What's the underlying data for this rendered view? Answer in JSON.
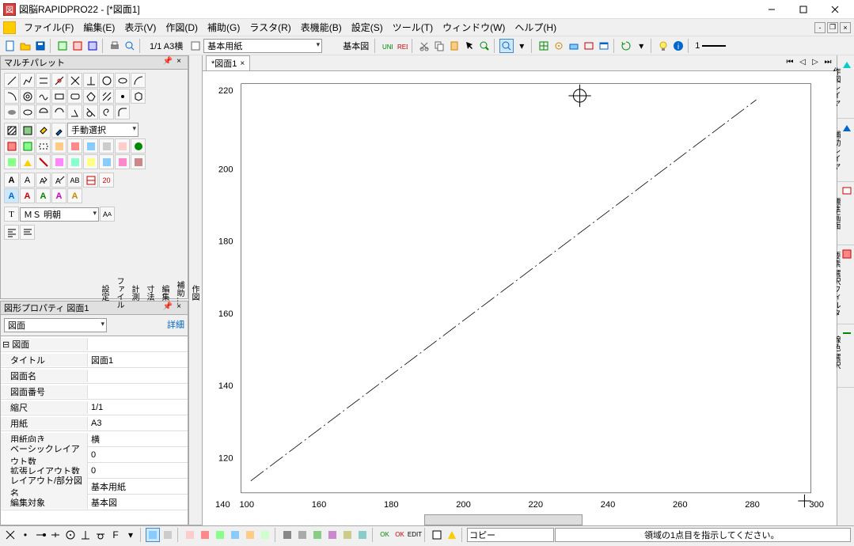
{
  "title": "図脳RAPIDPRO22 - [*図面1]",
  "menus": [
    "ファイル(F)",
    "編集(E)",
    "表示(V)",
    "作図(D)",
    "補助(G)",
    "ラスタ(R)",
    "表機能(B)",
    "設定(S)",
    "ツール(T)",
    "ウィンドウ(W)",
    "ヘルプ(H)"
  ],
  "page_info": "1/1 A3横",
  "paper_label": "基本用紙",
  "view_label": "基本図",
  "line_weight": "1",
  "palette_title": "マルチパレット",
  "select_mode": "手動選択",
  "font_name": "ＭＳ 明朝",
  "prop_title": "図形プロパティ 図面1",
  "prop_dropdown": "図面",
  "prop_detail": "詳細",
  "prop_rows": [
    {
      "k": "図面",
      "v": "",
      "head": true
    },
    {
      "k": "タイトル",
      "v": "図面1"
    },
    {
      "k": "図面名",
      "v": ""
    },
    {
      "k": "図面番号",
      "v": ""
    },
    {
      "k": "縮尺",
      "v": "1/1"
    },
    {
      "k": "用紙",
      "v": "A3"
    },
    {
      "k": "用紙向き",
      "v": "横"
    },
    {
      "k": "ベーシックレイアウト数",
      "v": "0"
    },
    {
      "k": "拡張レイアウト数",
      "v": "0"
    },
    {
      "k": "レイアウト/部分図名",
      "v": "基本用紙"
    },
    {
      "k": "編集対象",
      "v": "基本図"
    }
  ],
  "vtabs": [
    "作図",
    "補助…",
    "編集",
    "寸法",
    "計測",
    "ファイル",
    "設定"
  ],
  "doc_tab": "*図面1",
  "right_tabs": [
    "作図レイヤ",
    "補助レイヤ",
    "標準画面",
    "要素 選択フィルタ",
    "線色 選択..."
  ],
  "status_mode": "コピー",
  "status_msg": "領域の1点目を指示してください。",
  "axis_y": [
    "220",
    "200",
    "180",
    "160",
    "140",
    "120"
  ],
  "axis_x": [
    "140",
    "100",
    "160",
    "180",
    "200",
    "220",
    "240",
    "260",
    "280",
    "300"
  ]
}
